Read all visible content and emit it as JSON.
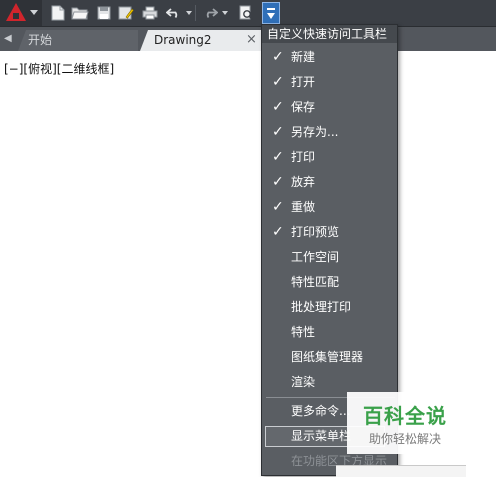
{
  "toolbar": {
    "icons": [
      "app-logo",
      "new-file",
      "open-folder",
      "save",
      "save-as",
      "print",
      "undo",
      "redo",
      "plot-preview",
      "customize"
    ]
  },
  "tabs": [
    {
      "label": "开始"
    },
    {
      "label": "Drawing2",
      "close": "×"
    }
  ],
  "viewport": {
    "label": "[−][俯视][二维线框]"
  },
  "menu": {
    "title": "自定义快速访问工具栏",
    "items": [
      {
        "label": "新建",
        "checked": true,
        "check": "✓"
      },
      {
        "label": "打开",
        "checked": true,
        "check": "✓"
      },
      {
        "label": "保存",
        "checked": true,
        "check": "✓"
      },
      {
        "label": "另存为...",
        "checked": true,
        "check": "✓"
      },
      {
        "label": "打印",
        "checked": true,
        "check": "✓"
      },
      {
        "label": "放弃",
        "checked": true,
        "check": "✓"
      },
      {
        "label": "重做",
        "checked": true,
        "check": "✓"
      },
      {
        "label": "打印预览",
        "checked": true,
        "check": "✓"
      },
      {
        "label": "工作空间",
        "checked": false
      },
      {
        "label": "特性匹配",
        "checked": false
      },
      {
        "label": "批处理打印",
        "checked": false
      },
      {
        "label": "特性",
        "checked": false
      },
      {
        "label": "图纸集管理器",
        "checked": false
      },
      {
        "label": "渲染",
        "checked": false
      }
    ],
    "more_commands": "更多命令...",
    "show_menubar": "显示菜单栏",
    "below_ribbon": "在功能区下方显示"
  },
  "watermark": {
    "title": "百科全说",
    "subtitle": "助你轻松解决"
  },
  "colors": {
    "accent": "#2f6fb8",
    "logo_red": "#d1252c",
    "watermark_green": "#3aa14a"
  }
}
